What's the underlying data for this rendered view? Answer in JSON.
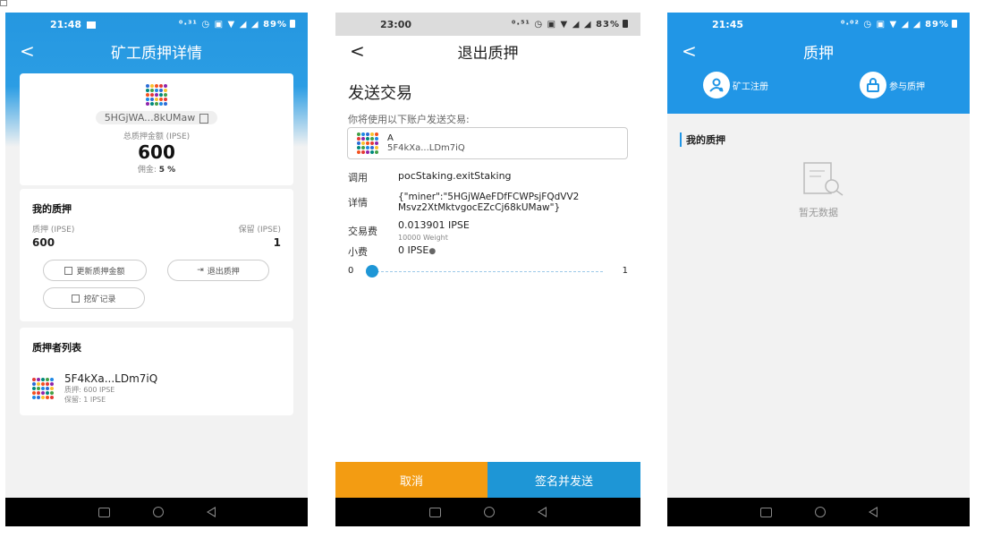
{
  "colors": {
    "primary": "#2196e6",
    "orange": "#f39c12",
    "dark_bar": "#000000"
  },
  "phone1": {
    "status": {
      "time": "21:48",
      "icons": "⁰⋅³¹ ◷ ▣ ▼ ◢ ◢",
      "battery": "89%"
    },
    "nav": {
      "title": "矿工质押详情"
    },
    "summary": {
      "address": "5HGjWA...8kUMaw",
      "total_label": "总质押金额 (IPSE)",
      "total_value": "600",
      "commission_label": "佣金:",
      "commission_value": "5 %"
    },
    "my_stake": {
      "title": "我的质押",
      "stake_label": "质押 (IPSE)",
      "reserve_label": "保留 (IPSE)",
      "stake_value": "600",
      "reserve_value": "1",
      "buttons": {
        "update": "更新质押金额",
        "exit": "退出质押",
        "mining": "挖矿记录"
      }
    },
    "stakers": {
      "title": "质押者列表",
      "items": [
        {
          "name": "5F4kXa...LDm7iQ",
          "stake": "质押: 600 IPSE",
          "reserve": "保留: 1 IPSE"
        }
      ]
    }
  },
  "phone2": {
    "status": {
      "time": "23:00",
      "icons": "⁰⋅⁵¹ ◷ ▣ ▼ ◢ ◢",
      "battery": "83%"
    },
    "nav": {
      "title": "退出质押"
    },
    "heading": "发送交易",
    "account_hint": "你将使用以下账户发送交易:",
    "account": {
      "name": "A",
      "address": "5F4kXa...LDm7iQ"
    },
    "call": {
      "label": "调用",
      "value": "pocStaking.exitStaking"
    },
    "details": {
      "label": "详情",
      "value_line1": "{\"miner\":\"5HGjWAeFDfFCWPsjFQdVV2",
      "value_line2": "Msvz2XtMktvgocEZcCj68kUMaw\"}"
    },
    "fee": {
      "label": "交易费",
      "value": "0.013901 IPSE",
      "weight": "10000 Weight"
    },
    "tip": {
      "label": "小费",
      "value": "0 IPSE"
    },
    "slider": {
      "min": "0",
      "max": "1",
      "value": 0
    },
    "buttons": {
      "cancel": "取消",
      "send": "签名并发送"
    }
  },
  "phone3": {
    "status": {
      "time": "21:45",
      "icons": "⁰⋅⁰² ◷ ▣ ▼ ◢ ◢",
      "battery": "89%"
    },
    "nav": {
      "title": "质押"
    },
    "actions": {
      "register": "矿工注册",
      "stake": "参与质押"
    },
    "section_title": "我的质押",
    "empty": "暂无数据"
  }
}
